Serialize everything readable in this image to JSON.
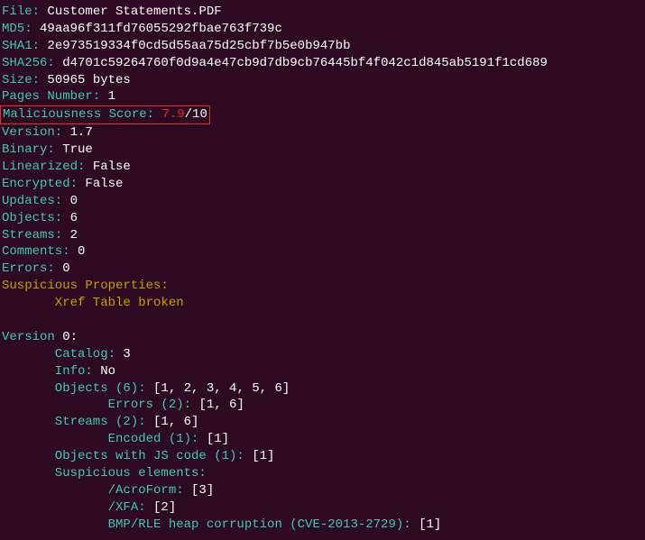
{
  "file": {
    "label": "File:",
    "value": "Customer Statements.PDF"
  },
  "md5": {
    "label": "MD5:",
    "value": "49aa96f311fd76055292fbae763f739c"
  },
  "sha1": {
    "label": "SHA1:",
    "value": "2e973519334f0cd5d55aa75d25cbf7b5e0b947bb"
  },
  "sha256": {
    "label": "SHA256:",
    "value": "d4701c59264760f0d9a4e47cb9d7db9cb76445bf4f042c1d845ab5191f1cd689"
  },
  "size": {
    "label": "Size:",
    "value": "50965 bytes"
  },
  "pages": {
    "label": "Pages Number:",
    "value": "1"
  },
  "malscore": {
    "label": "Maliciousness Score: ",
    "value": "7.9",
    "suffix": "/10"
  },
  "pdfversion": {
    "label": "Version:",
    "value": "1.7"
  },
  "binary": {
    "label": "Binary:",
    "value": "True"
  },
  "linearized": {
    "label": "Linearized:",
    "value": "False"
  },
  "encrypted": {
    "label": "Encrypted:",
    "value": "False"
  },
  "updates": {
    "label": "Updates:",
    "value": "0"
  },
  "objects": {
    "label": "Objects:",
    "value": "6"
  },
  "streams": {
    "label": "Streams:",
    "value": "2"
  },
  "comments": {
    "label": "Comments:",
    "value": "0"
  },
  "errors": {
    "label": "Errors:",
    "value": "0"
  },
  "susp_props": {
    "label": "Suspicious Properties:",
    "items": [
      "Xref Table broken"
    ]
  },
  "version0": {
    "label": "Version",
    "num": "0:",
    "catalog": {
      "label": "Catalog:",
      "value": "3"
    },
    "info": {
      "label": "Info:",
      "value": "No"
    },
    "objects": {
      "label": "Objects (6):",
      "value": "[1, 2, 3, 4, 5, 6]"
    },
    "errors": {
      "label": "Errors (2):",
      "value": "[1, 6]"
    },
    "streams": {
      "label": "Streams (2):",
      "value": "[1, 6]"
    },
    "encoded": {
      "label": "Encoded (1):",
      "value": "[1]"
    },
    "jscode": {
      "label": "Objects with JS code (1):",
      "value": "[1]"
    },
    "susp_elem": {
      "label": "Suspicious elements:"
    },
    "acroform": {
      "label": "/AcroForm:",
      "value": "[3]"
    },
    "xfa": {
      "label": "/XFA:",
      "value": "[2]"
    },
    "bmp": {
      "label": "BMP/RLE heap corruption (CVE-2013-2729):",
      "value": "[1]"
    }
  }
}
